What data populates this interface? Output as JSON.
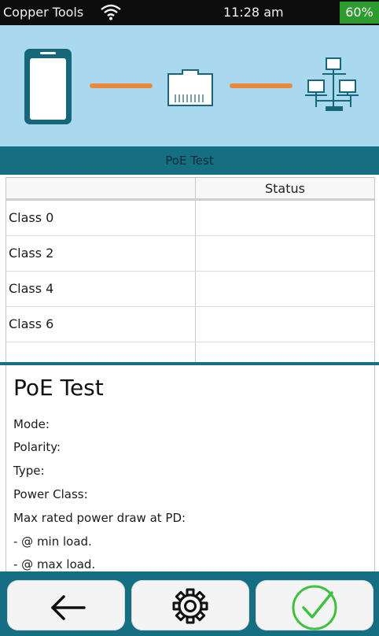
{
  "statusbar": {
    "app_title": "Copper Tools",
    "time": "11:28 am",
    "battery": "60%",
    "icons": {
      "wifi": "wifi-icon"
    }
  },
  "diagram": {
    "icons": [
      "tester-device-icon",
      "rj45-port-icon",
      "network-devices-icon"
    ],
    "colors": {
      "background": "#a9d8ef",
      "link": "#e8883a",
      "device": "#17677a"
    }
  },
  "section": {
    "title": "PoE Test"
  },
  "table": {
    "columns": [
      "",
      "Status"
    ],
    "rows": [
      {
        "label": "Class 0",
        "status": ""
      },
      {
        "label": "Class 2",
        "status": ""
      },
      {
        "label": "Class 4",
        "status": ""
      },
      {
        "label": "Class 6",
        "status": ""
      }
    ]
  },
  "details": {
    "title": "PoE Test",
    "fields": {
      "mode": "Mode:",
      "polarity": "Polarity:",
      "type": "Type:",
      "power_class": "Power Class:",
      "max_rated": "Max rated power draw at PD:",
      "min_load": "- @ min load.",
      "max_load": "- @ max load."
    }
  },
  "buttons": {
    "back": "back-arrow-icon",
    "settings": "gear-icon",
    "ok": "check-circle-icon"
  },
  "colors": {
    "accent": "#156e82",
    "battery": "#2e9b2e",
    "check": "#3fc13f"
  }
}
